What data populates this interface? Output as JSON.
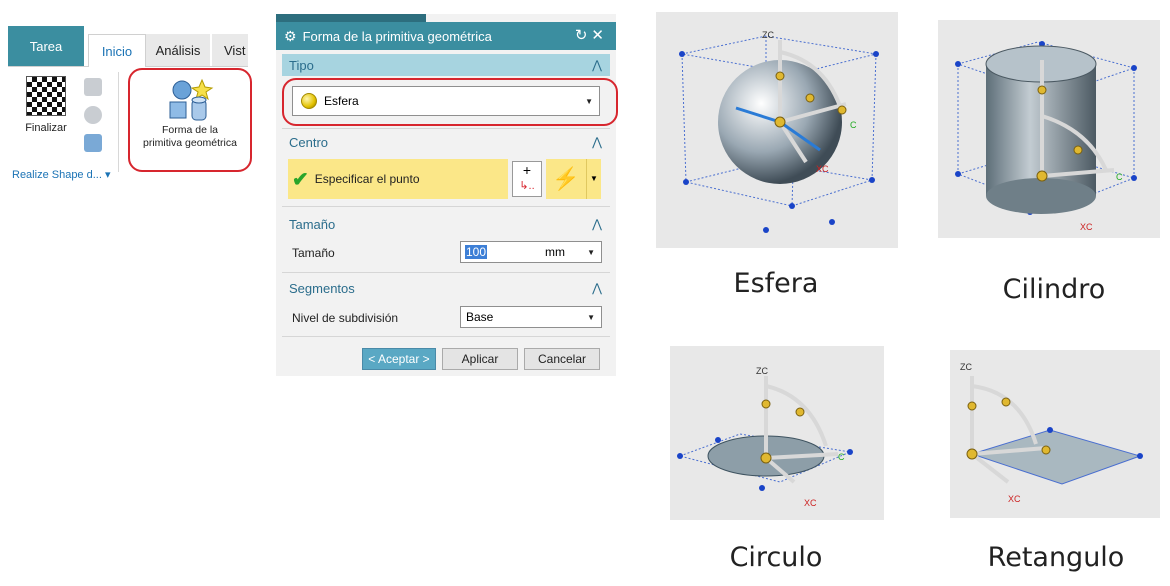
{
  "ribbon": {
    "tabs": [
      "Tarea",
      "Inicio",
      "Análisis",
      "Vist"
    ],
    "finalizar_label": "Finalizar",
    "forma_label_1": "Forma de la",
    "forma_label_2": "primitiva geométrica",
    "group_label": "Realize Shape d... ▾"
  },
  "dialog": {
    "title": "Forma de la primitiva geométrica",
    "title_controls": "↻✕",
    "tipo": {
      "header": "Tipo",
      "value": "Esfera"
    },
    "centro": {
      "header": "Centro",
      "specify": "Especificar el punto"
    },
    "tamano": {
      "header": "Tamaño",
      "label": "Tamaño",
      "value": "100",
      "unit": "mm"
    },
    "segmentos": {
      "header": "Segmentos",
      "label": "Nivel de subdivisión",
      "value": "Base"
    },
    "buttons": {
      "ok": "< Aceptar >",
      "apply": "Aplicar",
      "cancel": "Cancelar"
    }
  },
  "previews": [
    {
      "caption": "Esfera",
      "axis_z": "ZC",
      "axis_x": "XC",
      "axis_y": "C"
    },
    {
      "caption": "Cilindro",
      "axis_x": "XC",
      "axis_y": "C"
    },
    {
      "caption": "Circulo",
      "axis_z": "ZC",
      "axis_x": "XC",
      "axis_y": "C"
    },
    {
      "caption": "Retangulo",
      "axis_z": "ZC",
      "axis_x": "XC"
    }
  ],
  "colors": {
    "accent": "#3b8ea0",
    "highlight": "#d7262e",
    "section_active": "#a7d4e0",
    "yellow": "#fbe788"
  }
}
